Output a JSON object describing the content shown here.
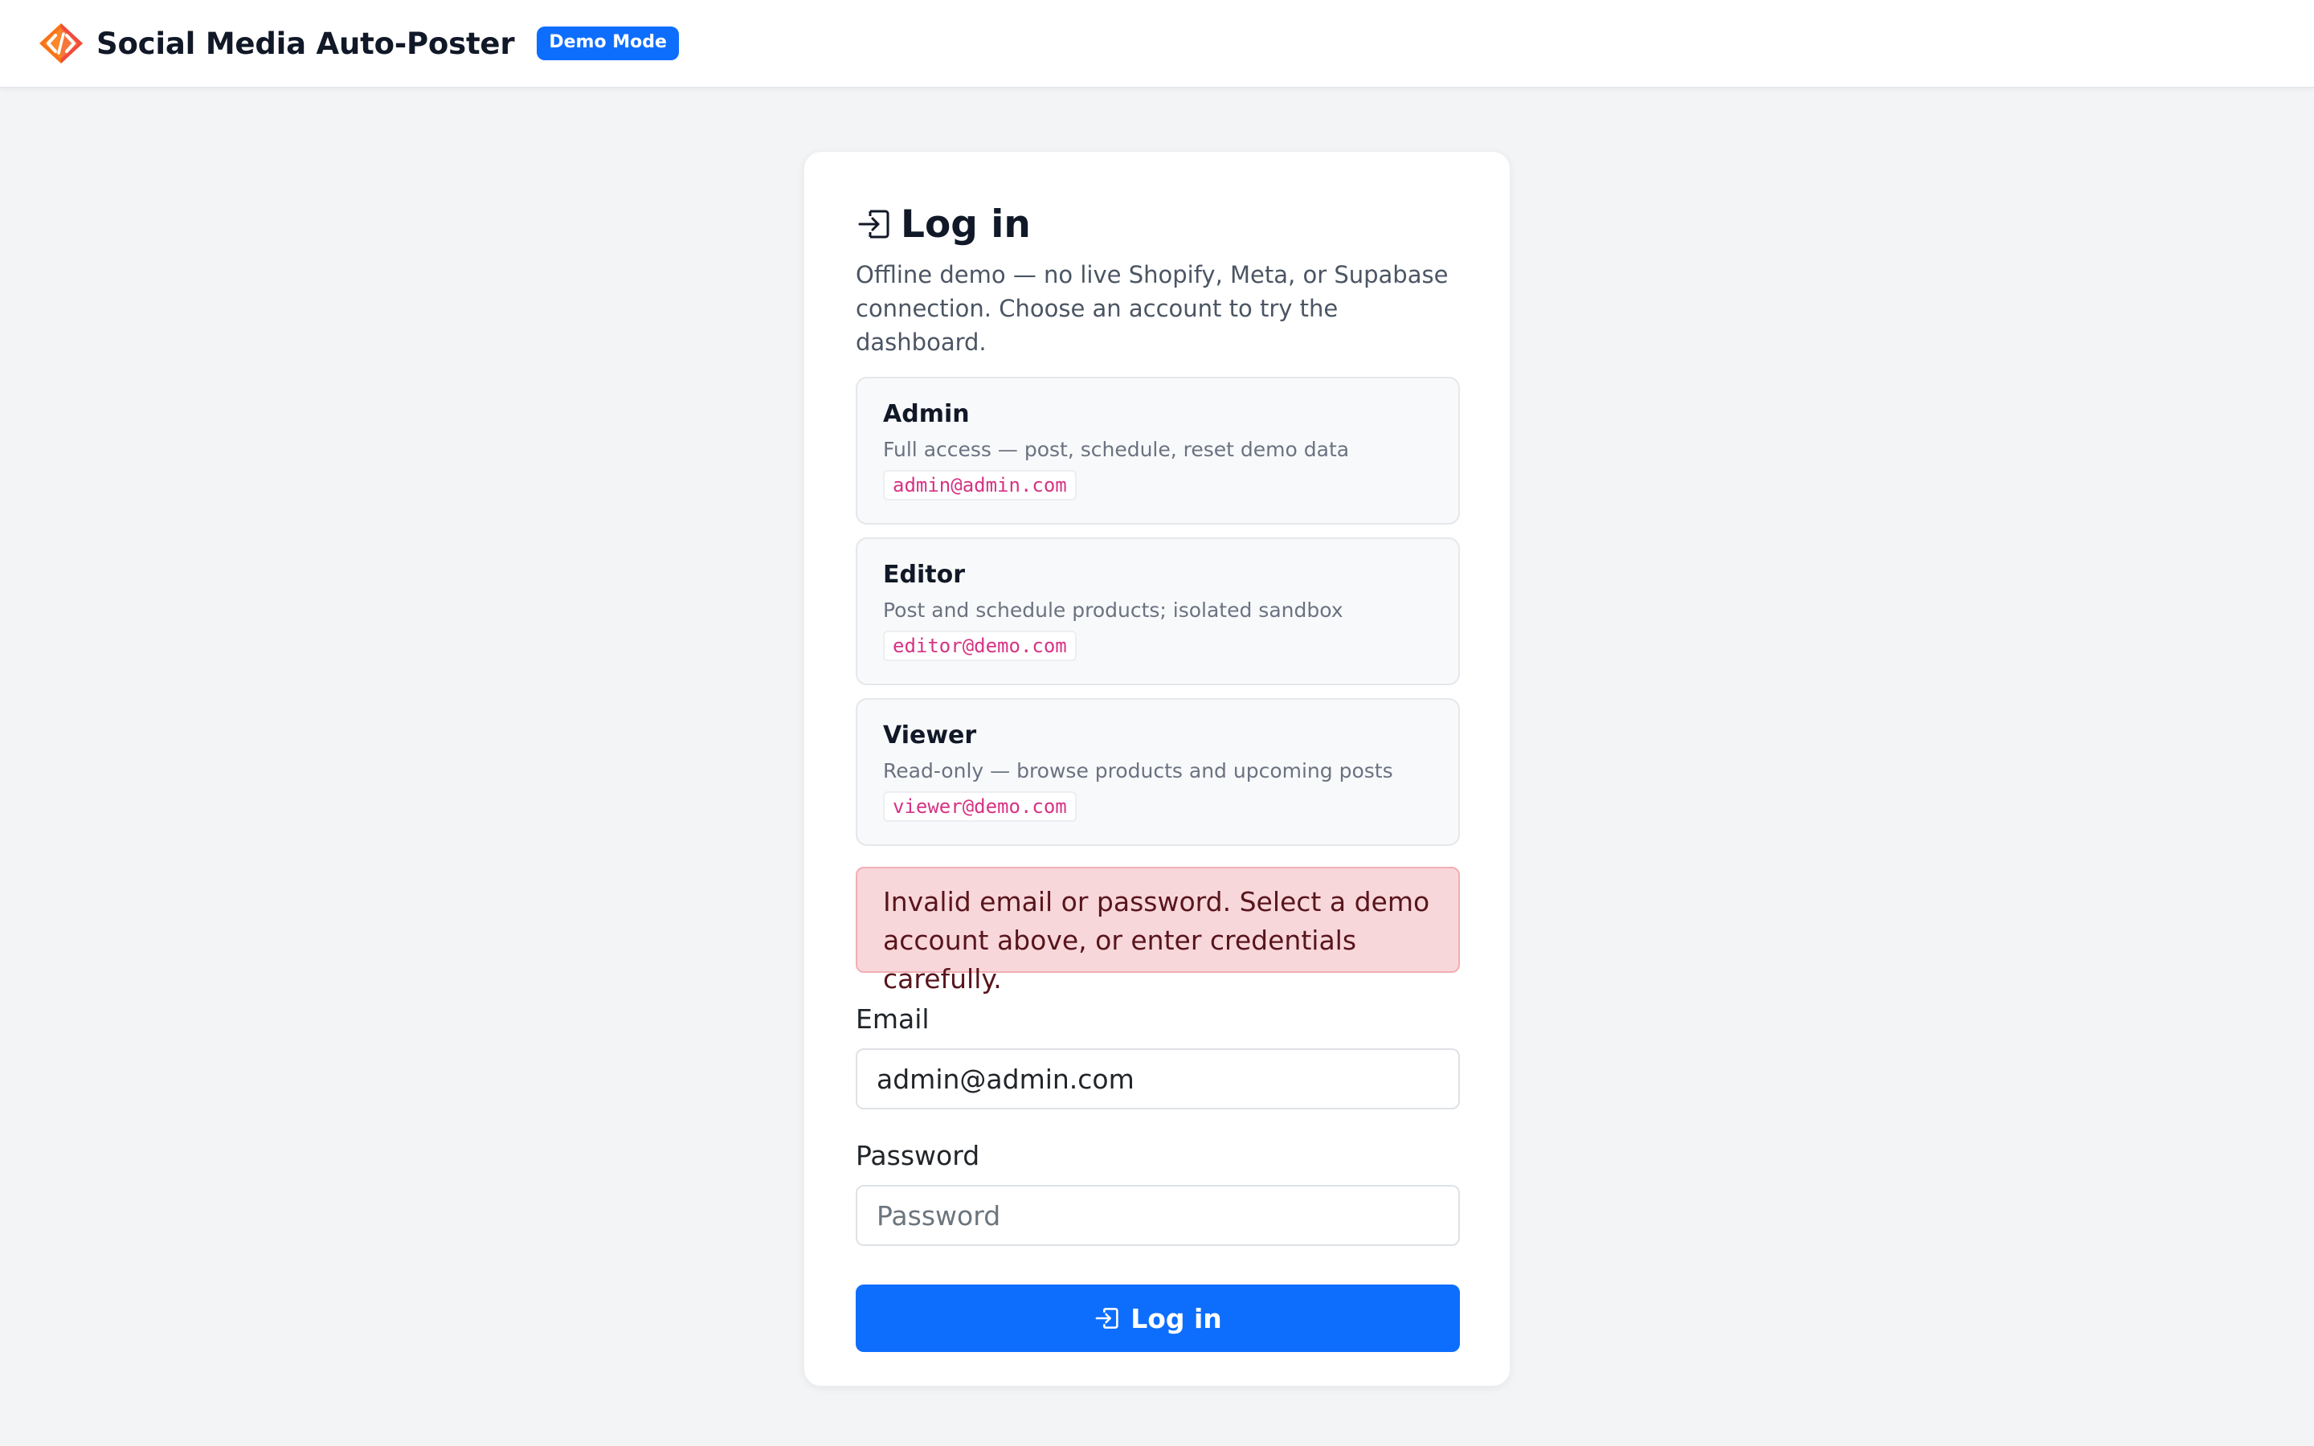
{
  "header": {
    "brand_name": "Social Media Auto-Poster",
    "badge": "Demo Mode",
    "logo_icon": "code-diamond-logo"
  },
  "login": {
    "title": "Log in",
    "title_icon": "login-icon",
    "subtitle": "Offline demo — no live Shopify, Meta, or Supabase connection. Choose an account to try the dashboard.",
    "accounts": [
      {
        "name": "Admin",
        "description": "Full access — post, schedule, reset demo data",
        "email": "admin@admin.com"
      },
      {
        "name": "Editor",
        "description": "Post and schedule products; isolated sandbox",
        "email": "editor@demo.com"
      },
      {
        "name": "Viewer",
        "description": "Read-only — browse products and upcoming posts",
        "email": "viewer@demo.com"
      }
    ],
    "error": "Invalid email or password. Select a demo account above, or enter credentials carefully.",
    "email_label": "Email",
    "email_value": "admin@admin.com",
    "email_placeholder": "",
    "password_label": "Password",
    "password_placeholder": "Password",
    "submit_label": "Log in"
  },
  "colors": {
    "accent": "#0d6efd",
    "page_bg": "#f3f4f6",
    "error_bg": "#f8d7da",
    "error_text": "#58151c",
    "email_code": "#d63384"
  }
}
